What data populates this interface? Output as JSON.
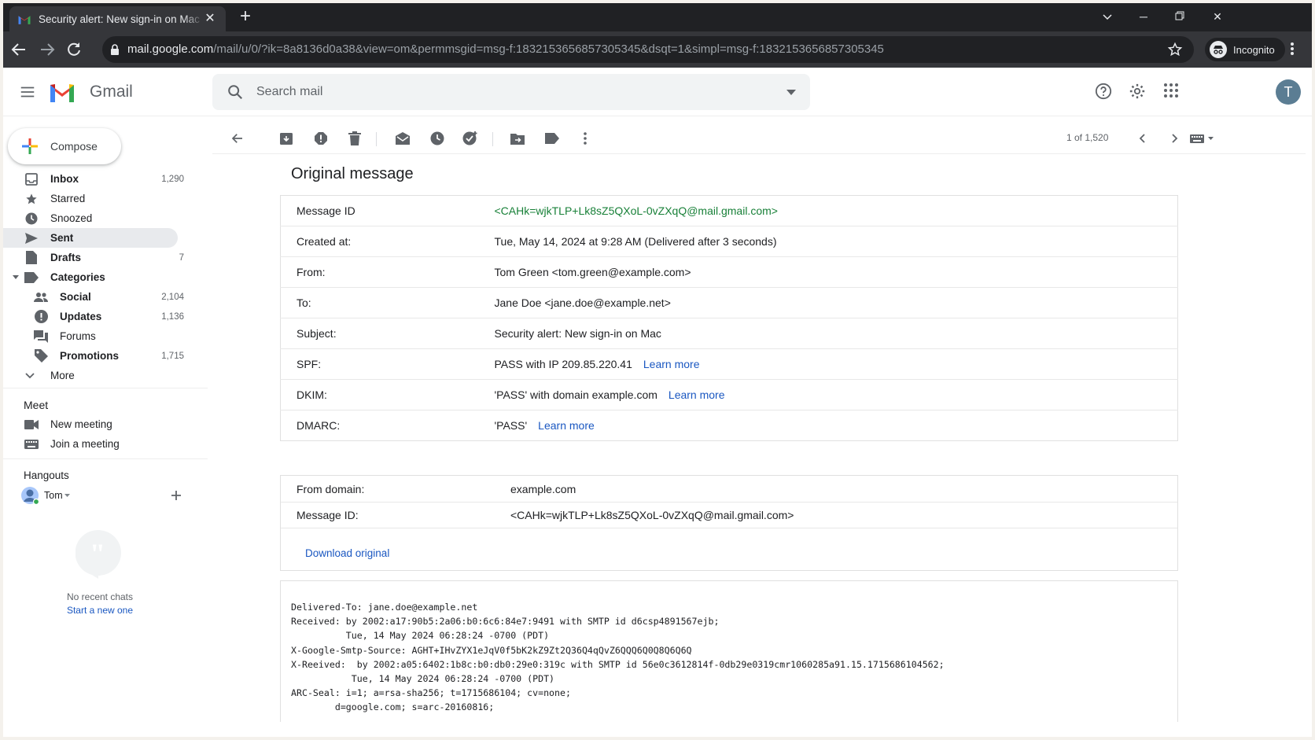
{
  "browser": {
    "tab_title": "Security alert: New sign-in on Mac",
    "url_host": "mail.google.com",
    "url_path": "/mail/u/0/?ik=8a8136d0a38&view=om&permmsgid=msg-f:1832153656857305345&dsqt=1&simpl=msg-f:1832153656857305345",
    "incognito_label": "Incognito"
  },
  "header": {
    "app_name": "Gmail",
    "search_placeholder": "Search mail",
    "avatar_letter": "T"
  },
  "sidebar": {
    "compose_label": "Compose",
    "items": [
      {
        "label": "Inbox",
        "count": "1,290",
        "icon": "inbox-icon"
      },
      {
        "label": "Starred",
        "count": "",
        "icon": "star-icon"
      },
      {
        "label": "Snoozed",
        "count": "",
        "icon": "clock-icon"
      },
      {
        "label": "Sent",
        "count": "",
        "icon": "send-icon"
      },
      {
        "label": "Drafts",
        "count": "7",
        "icon": "draft-icon"
      },
      {
        "label": "Categories",
        "count": "",
        "icon": "label-icon"
      },
      {
        "label": "Social",
        "count": "2,104",
        "icon": "people-icon"
      },
      {
        "label": "Updates",
        "count": "1,136",
        "icon": "info-icon"
      },
      {
        "label": "Forums",
        "count": "",
        "icon": "forum-icon"
      },
      {
        "label": "Promotions",
        "count": "1,715",
        "icon": "tag-icon"
      },
      {
        "label": "More",
        "count": "",
        "icon": "chevron-down-icon"
      }
    ],
    "meet": {
      "title": "Meet",
      "new_meeting": "New meeting",
      "join_meeting": "Join a meeting"
    },
    "hangouts": {
      "title": "Hangouts",
      "user": "Tom",
      "no_chats": "No recent chats",
      "start_new": "Start a new one"
    }
  },
  "toolbar": {
    "pager": "1 of 1,520"
  },
  "message": {
    "title": "Original message",
    "rows": [
      {
        "key": "Message ID",
        "value": "<CAHk=wjkTLP+Lk8sZ5QXoL-0vZXqQ@mail.gmail.com>",
        "link": ""
      },
      {
        "key": "Created at:",
        "value": "Tue, May 14, 2024 at 9:28 AM (Delivered after 3 seconds)",
        "link": ""
      },
      {
        "key": "From:",
        "value": "Tom Green <tom.green@example.com>",
        "link": ""
      },
      {
        "key": "To:",
        "value": "Jane Doe <jane.doe@example.net>",
        "link": ""
      },
      {
        "key": "Subject:",
        "value": "Security alert: New sign-in on Mac",
        "link": ""
      },
      {
        "key": "SPF:",
        "value": "PASS with IP 209.85.220.41",
        "link": "Learn more"
      },
      {
        "key": "DKIM:",
        "value": "'PASS' with domain example.com",
        "link": "Learn more"
      },
      {
        "key": "DMARC:",
        "value": "'PASS'",
        "link": "Learn more"
      }
    ],
    "from_domain_label": "From domain:",
    "from_domain": "example.com",
    "message_id_label": "Message ID:",
    "message_id": "<CAHk=wjkTLP+Lk8sZ5QXoL-0vZXqQ@mail.gmail.com>",
    "download_label": "Download original",
    "raw": "Delivered-To: jane.doe@example.net\nReceived: by 2002:a17:90b5:2a06:b0:6c6:84e7:9491 with SMTP id d6csp4891567ejb;\n          Tue, 14 May 2024 06:28:24 -0700 (PDT)\nX-Google-Smtp-Source: AGHT+IHvZYX1eJqV0f5bK2kZ9Zt2Q36Q4qQvZ6QQQ6Q0Q8Q6Q6Q\nX-Reeived:  by 2002:a05:6402:1b8c:b0:db0:29e0:319c with SMTP id 56e0c3612814f-0db29e0319cmr1060285a91.15.1715686104562;\n           Tue, 14 May 2024 06:28:24 -0700 (PDT)\nARC-Seal: i=1; a=rsa-sha256; t=1715686104; cv=none;\n        d=google.com; s=arc-20160816;"
  },
  "colors": {
    "accent_link": "#1a57c1",
    "message_id_green": "#188038",
    "chrome_dark": "#202124"
  }
}
